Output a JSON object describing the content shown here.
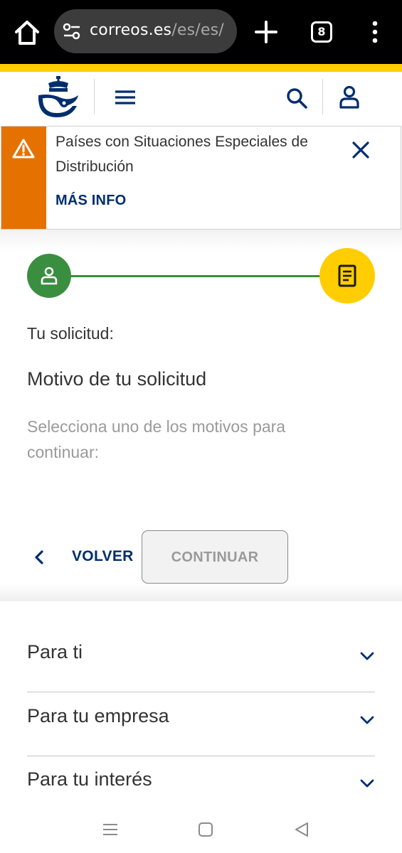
{
  "browser": {
    "url_main": "correos.es",
    "url_dim": "/es/es/",
    "tab_count": "8"
  },
  "alert": {
    "text": "Países con Situaciones Especiales de Distribución",
    "link": "MÁS INFO"
  },
  "stepper": {
    "steps": [
      {
        "icon": "user-icon",
        "state": "completed",
        "color": "#3a8e3f"
      },
      {
        "icon": "document-icon",
        "state": "current",
        "color": "#ffcd00"
      }
    ]
  },
  "form": {
    "section": "Tu solicitud:",
    "title": "Motivo de tu solicitud",
    "instruction": "Selecciona uno de los motivos para continuar:"
  },
  "actions": {
    "back_label": "VOLVER",
    "continue_label": "CONTINUAR"
  },
  "footer": {
    "items": [
      {
        "label": "Para ti"
      },
      {
        "label": "Para tu empresa"
      },
      {
        "label": "Para tu interés"
      }
    ]
  },
  "colors": {
    "brand_yellow": "#ffcd00",
    "brand_blue": "#002e6d",
    "alert_orange": "#e57200",
    "success_green": "#3a8e3f"
  }
}
